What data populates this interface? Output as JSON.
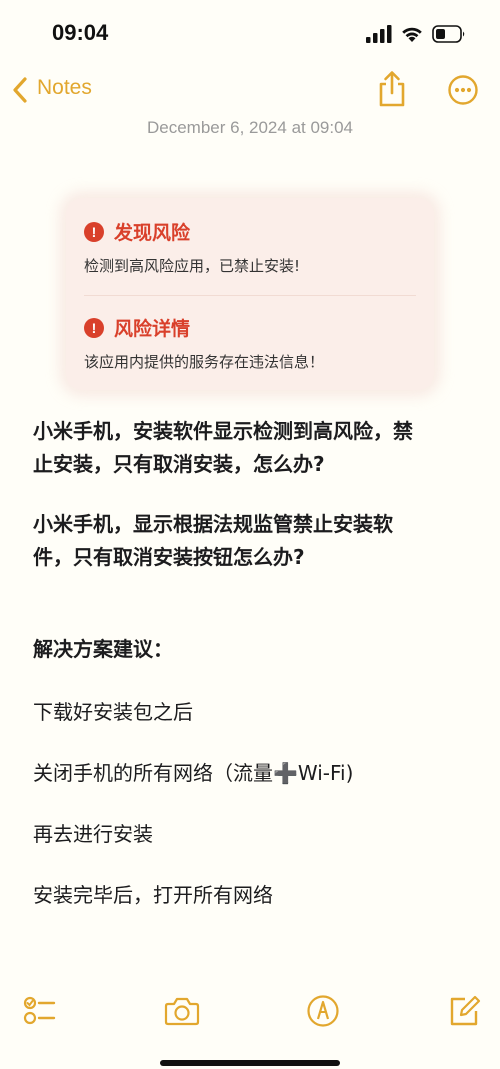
{
  "status_bar": {
    "time": "09:04",
    "icons": [
      "cellular-signal-icon",
      "wifi-icon",
      "battery-icon"
    ]
  },
  "nav": {
    "back_label": "Notes",
    "icons": [
      "chevron-left-icon",
      "share-icon",
      "more-icon"
    ]
  },
  "note": {
    "date": "December 6, 2024 at 09:04",
    "alert_card": {
      "title_1": "发现风险",
      "body_1": "检测到高风险应用，已禁止安装!",
      "title_2": "风险详情",
      "body_2": "该应用内提供的服务存在违法信息！",
      "icon": "exclamation-circle-icon"
    },
    "paragraphs": {
      "q1_line1": "小米手机，安装软件显示检测到高风险，禁",
      "q1_line2": "止安装，只有取消安装，怎么办?",
      "q2_line1": "小米手机，显示根据法规监管禁止安装软",
      "q2_line2": "件，只有取消安装按钮怎么办?",
      "heading": "解决方案建议：",
      "step1": "下载好安装包之后",
      "step2": "关闭手机的所有网络（流量➕Wi-Fi)",
      "step3": "再去进行安装",
      "step4": "安装完毕后，打开所有网络"
    }
  },
  "toolbar": {
    "icons": [
      "checklist-icon",
      "camera-icon",
      "markup-pen-icon",
      "compose-icon"
    ]
  },
  "colors": {
    "accent": "#e2a72e",
    "alert_red": "#d9402b",
    "alert_bg": "#fbeee9",
    "background": "#fffef8",
    "date_gray": "#9a9a9a"
  }
}
